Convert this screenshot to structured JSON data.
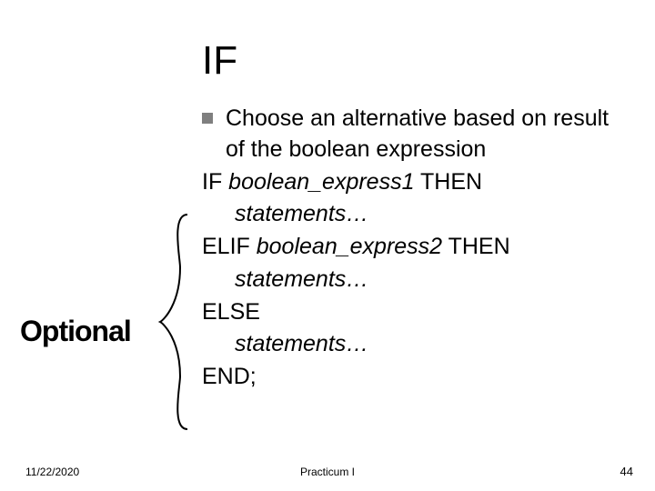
{
  "title": "IF",
  "bullet": "Choose an alternative based on result of the boolean expression",
  "code": {
    "l1a": "IF ",
    "l1b": "boolean_express1",
    "l1c": " THEN",
    "l2": "statements…",
    "l3a": "ELIF ",
    "l3b": "boolean_express2",
    "l3c": " THEN",
    "l4": "statements…",
    "l5": "ELSE",
    "l6": "statements…",
    "l7": "END;"
  },
  "callout": "Optional",
  "footer": {
    "date": "11/22/2020",
    "center": "Practicum I",
    "page": "44"
  }
}
